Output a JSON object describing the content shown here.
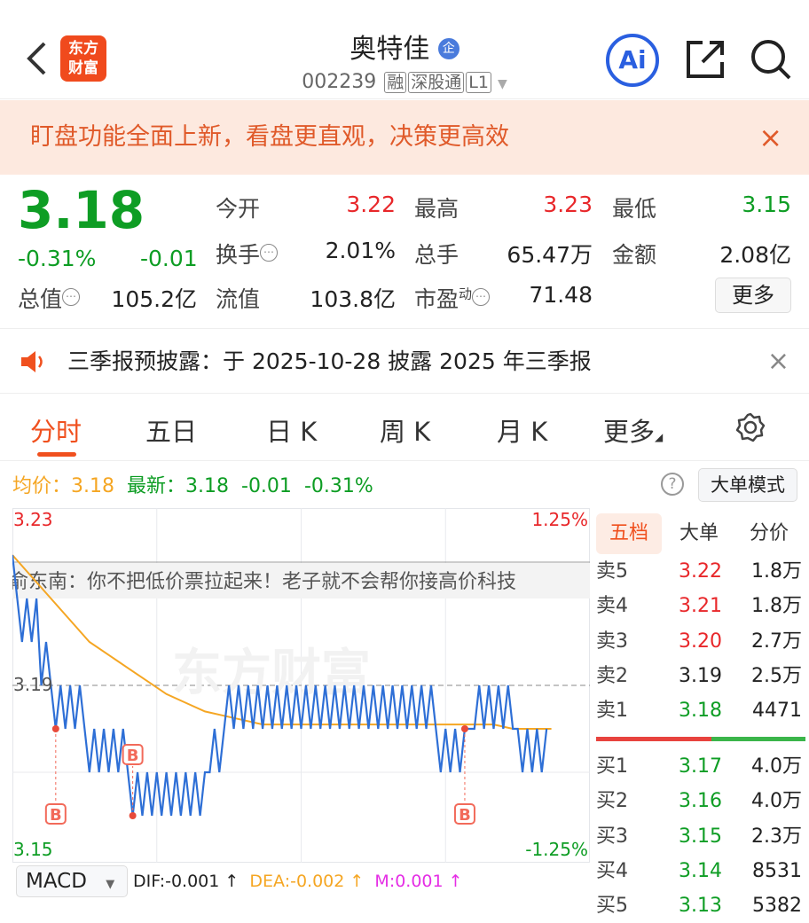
{
  "header": {
    "back_icon": "chevron-left",
    "logo_text": [
      "东方",
      "财富"
    ],
    "title": "奥特佳",
    "enterprise_badge": "企",
    "code": "002239",
    "tags": [
      "融",
      "深股通",
      "L1"
    ],
    "ai_label": "Ai",
    "share_icon": "share-icon",
    "search_icon": "search-icon"
  },
  "banner": {
    "text": "盯盘功能全面上新，看盘更直观，决策更高效",
    "close": "×"
  },
  "quote": {
    "price": "3.18",
    "change_pct": "-0.31%",
    "change": "-0.01",
    "fields": [
      {
        "label": "今开",
        "value": "3.22",
        "color": "red"
      },
      {
        "label": "最高",
        "value": "3.23",
        "color": "red"
      },
      {
        "label": "最低",
        "value": "3.15",
        "color": "green"
      },
      {
        "label": "换手",
        "value": "2.01%"
      },
      {
        "label": "总手",
        "value": "65.47万"
      },
      {
        "label": "金额",
        "value": "2.08亿"
      },
      {
        "label": "总值",
        "value": "105.2亿"
      },
      {
        "label": "流值",
        "value": "103.8亿"
      },
      {
        "label": "市盈",
        "sup": "动",
        "value": "71.48"
      }
    ],
    "more_button": "更多"
  },
  "notice": {
    "text": "三季报预披露：于 2025-10-28 披露 2025 年三季报",
    "close": "×"
  },
  "tabs": {
    "items": [
      "分时",
      "五日",
      "日 K",
      "周 K",
      "月 K",
      "更多"
    ],
    "active": 0,
    "accent": "#f0501e"
  },
  "legend": {
    "avg_label": "均价：",
    "avg": "3.18",
    "latest_label": "最新：",
    "latest": "3.18",
    "change": "-0.01",
    "change_pct": "-0.31%",
    "help": "?",
    "big_order_button": "大单模式"
  },
  "chart_overlay_text": "俞东南：你不把低价票拉起来！老子就不会帮你接高价科技",
  "watermark": "东方财富",
  "chart_data": {
    "type": "line",
    "ylim": [
      3.15,
      3.23
    ],
    "prev_close": 3.19,
    "y_labels_left": [
      "3.23",
      "3.19",
      "3.15"
    ],
    "y_labels_right": [
      "1.25%",
      "-1.25%"
    ],
    "price": [
      3.22,
      3.21,
      3.2,
      3.21,
      3.2,
      3.21,
      3.19,
      3.2,
      3.19,
      3.18,
      3.19,
      3.18,
      3.19,
      3.18,
      3.19,
      3.18,
      3.17,
      3.18,
      3.17,
      3.18,
      3.17,
      3.18,
      3.17,
      3.18,
      3.17,
      3.16,
      3.17,
      3.16,
      3.17,
      3.16,
      3.17,
      3.16,
      3.17,
      3.16,
      3.17,
      3.16,
      3.17,
      3.16,
      3.17,
      3.16,
      3.17,
      3.17,
      3.18,
      3.17,
      3.18,
      3.19,
      3.18,
      3.19,
      3.18,
      3.19,
      3.18,
      3.19,
      3.18,
      3.19,
      3.18,
      3.19,
      3.18,
      3.19,
      3.18,
      3.19,
      3.18,
      3.19,
      3.18,
      3.19,
      3.18,
      3.19,
      3.18,
      3.19,
      3.18,
      3.19,
      3.18,
      3.19,
      3.18,
      3.19,
      3.18,
      3.19,
      3.18,
      3.19,
      3.18,
      3.19,
      3.18,
      3.19,
      3.18,
      3.19,
      3.18,
      3.19,
      3.18,
      3.19,
      3.18,
      3.17,
      3.18,
      3.17,
      3.18,
      3.17,
      3.18,
      3.18,
      3.18,
      3.19,
      3.18,
      3.19,
      3.18,
      3.19,
      3.18,
      3.19,
      3.18,
      3.18,
      3.17,
      3.18,
      3.17,
      3.18,
      3.17,
      3.18
    ],
    "avg": [
      3.22,
      3.215,
      3.21,
      3.205,
      3.2,
      3.197,
      3.194,
      3.191,
      3.188,
      3.186,
      3.184,
      3.183,
      3.182,
      3.181,
      3.181,
      3.181,
      3.181,
      3.181,
      3.181,
      3.181,
      3.181,
      3.181,
      3.181,
      3.181,
      3.181,
      3.181,
      3.18,
      3.18,
      3.18
    ],
    "buy_markers": [
      {
        "index": 9,
        "price": 3.18,
        "label": "B"
      },
      {
        "index": 25,
        "price": 3.16,
        "label": "B"
      },
      {
        "index": 94,
        "price": 3.18,
        "label": "B"
      }
    ],
    "colors": {
      "price": "#2e6fd6",
      "avg": "#f5a623",
      "marker": "#f26a5a"
    }
  },
  "order_book": {
    "tabs": [
      "五档",
      "大单",
      "分价"
    ],
    "asks": [
      {
        "label": "卖5",
        "price": "3.22",
        "vol": "1.8万",
        "color": "red"
      },
      {
        "label": "卖4",
        "price": "3.21",
        "vol": "1.8万",
        "color": "red"
      },
      {
        "label": "卖3",
        "price": "3.20",
        "vol": "2.7万",
        "color": "red"
      },
      {
        "label": "卖2",
        "price": "3.19",
        "vol": "2.5万",
        "color": "gray"
      },
      {
        "label": "卖1",
        "price": "3.18",
        "vol": "4471",
        "color": "green"
      }
    ],
    "bids": [
      {
        "label": "买1",
        "price": "3.17",
        "vol": "4.0万"
      },
      {
        "label": "买2",
        "price": "3.16",
        "vol": "4.0万"
      },
      {
        "label": "买3",
        "price": "3.15",
        "vol": "2.3万"
      },
      {
        "label": "买4",
        "price": "3.14",
        "vol": "8531"
      },
      {
        "label": "买5",
        "price": "3.13",
        "vol": "5382"
      }
    ]
  },
  "macd": {
    "selector": "MACD",
    "dif": "DIF:-0.001 ↑",
    "dea": "DEA:-0.002 ↑",
    "m": "M:0.001 ↑"
  }
}
